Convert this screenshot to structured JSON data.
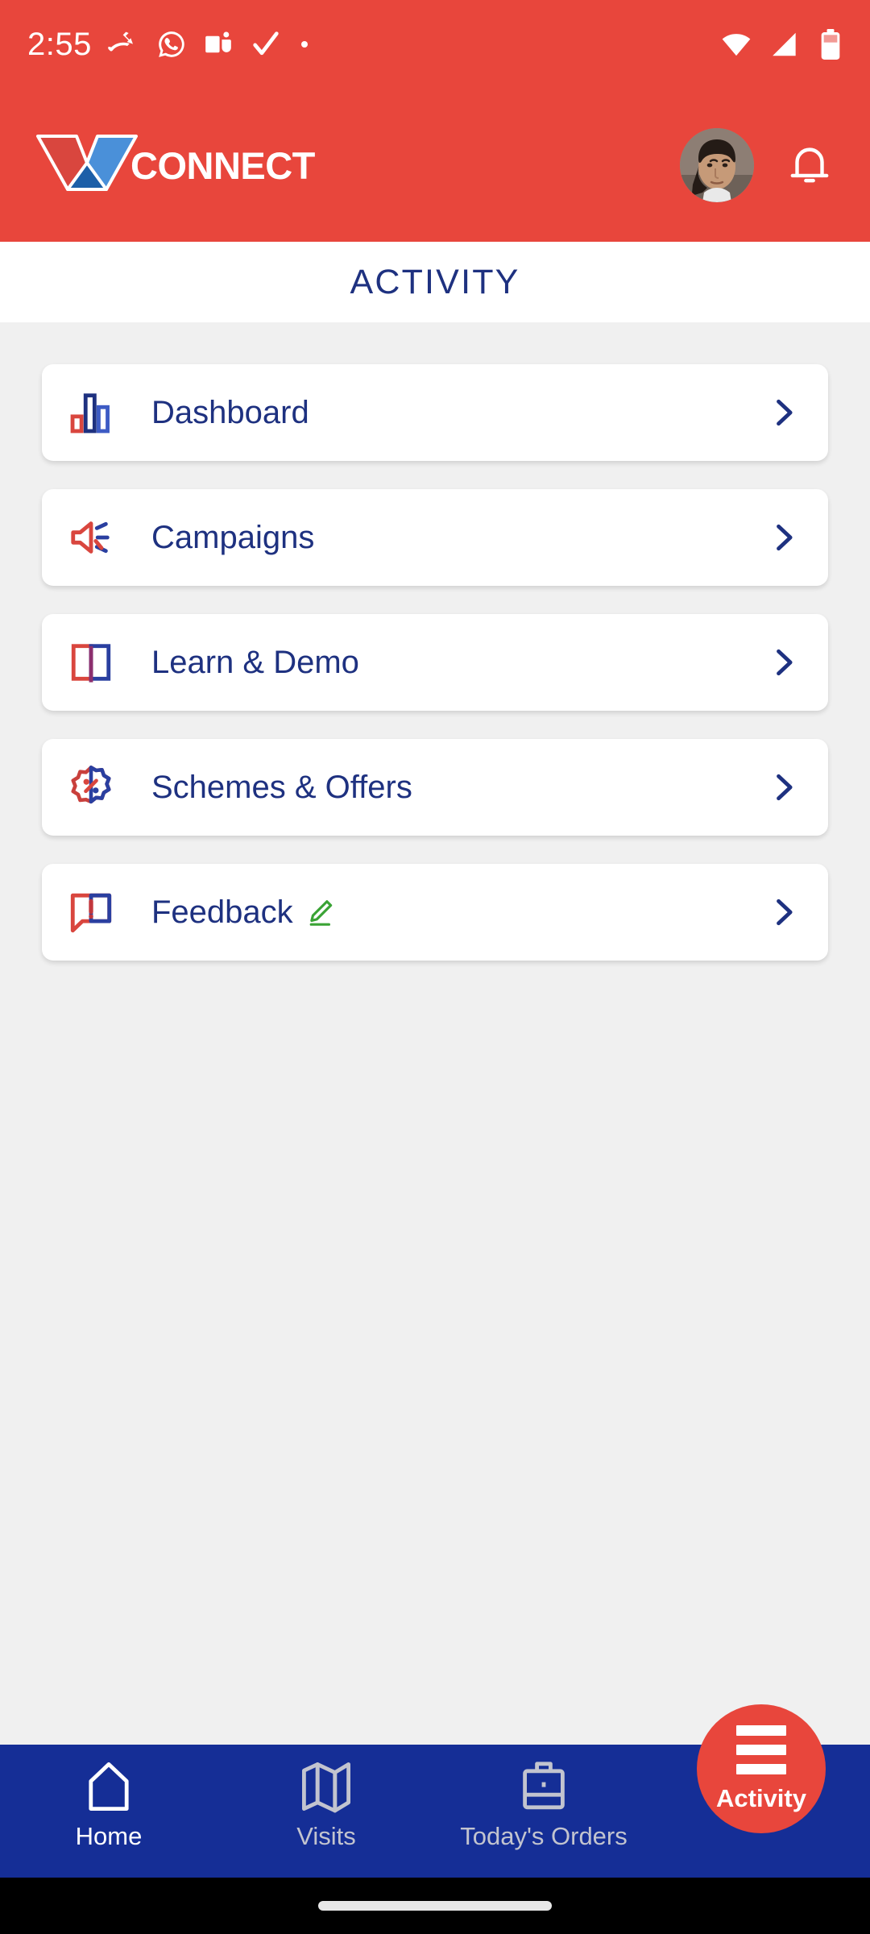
{
  "theme": {
    "brand_red": "#E8463C",
    "brand_navy": "#1E3180",
    "nav_blue": "#152E96",
    "page_bg": "#F0F0F0",
    "card_bg": "#FFFFFF",
    "edit_green": "#3AA335"
  },
  "status_bar": {
    "time": "2:55",
    "left_icons": [
      "missed-call-icon",
      "whatsapp-icon",
      "microsoft-teams-icon",
      "checkmark-icon",
      "dot-icon"
    ],
    "right_icons": [
      "wifi-icon",
      "cellular-signal-icon",
      "battery-icon"
    ]
  },
  "header": {
    "logo_text": "CONNECT",
    "logo_mark": "v-logo-icon",
    "avatar_name": "avatar",
    "notification_icon": "bell-icon"
  },
  "page_title": "ACTIVITY",
  "menu": {
    "items": [
      {
        "label": "Dashboard",
        "icon": "bar-chart-icon",
        "chevron": "chevron-right-icon",
        "badge": ""
      },
      {
        "label": "Campaigns",
        "icon": "megaphone-icon",
        "chevron": "chevron-right-icon",
        "badge": ""
      },
      {
        "label": "Learn & Demo",
        "icon": "open-book-icon",
        "chevron": "chevron-right-icon",
        "badge": ""
      },
      {
        "label": "Schemes & Offers",
        "icon": "discount-badge-icon",
        "chevron": "chevron-right-icon",
        "badge": ""
      },
      {
        "label": "Feedback",
        "icon": "feedback-alert-icon",
        "chevron": "chevron-right-icon",
        "badge": "edit-pencil-icon"
      }
    ]
  },
  "bottom_nav": {
    "items": [
      {
        "label": "Home",
        "icon": "home-icon",
        "active": true
      },
      {
        "label": "Visits",
        "icon": "map-icon",
        "active": false
      },
      {
        "label": "Today's Orders",
        "icon": "briefcase-icon",
        "active": false
      }
    ],
    "fab": {
      "label": "Activity",
      "icon": "hamburger-menu-icon"
    }
  }
}
